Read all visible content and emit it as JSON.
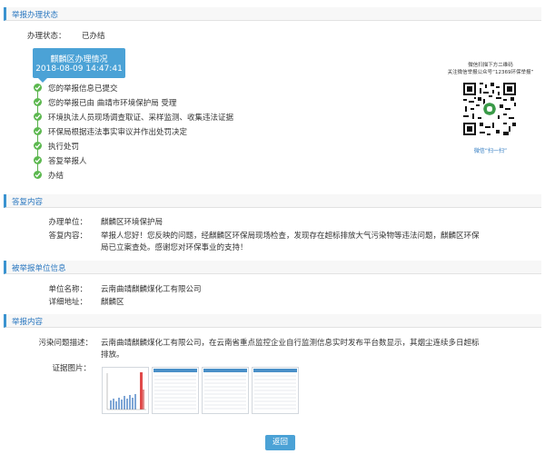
{
  "section_status": {
    "title": "举报办理状态"
  },
  "status": {
    "label": "办理状态：",
    "value": "已办结"
  },
  "card": {
    "title": "麒麟区办理情况",
    "time": "2018-08-09 14:47:41"
  },
  "steps": [
    "您的举报信息已提交",
    "您的举报已由 曲靖市环境保护局 受理",
    "环境执法人员现场调查取证、采样监测、收集违法证据",
    "环保局根据违法事实审议并作出处罚决定",
    "执行处罚",
    "答复举报人",
    "办结"
  ],
  "qr": {
    "caption_line1": "微信扫描下方二维码",
    "caption_line2": "关注微信举报公众号“12369环保举报”",
    "footer": "微信“扫一扫”"
  },
  "section_reply": {
    "title": "答复内容"
  },
  "reply": {
    "unit_label": "办理单位：",
    "unit_value": "麒麟区环境保护局",
    "content_label": "答复内容：",
    "content_line1": "举报人您好！您反映的问题，经麒麟区环保局现场检查，发现存在超标排放大气污染物等违法问题，麒麟区环保",
    "content_line2": "局已立案查处。感谢您对环保事业的支持！"
  },
  "section_reported": {
    "title": "被举报单位信息"
  },
  "reported": {
    "name_label": "单位名称：",
    "name_value": "云南曲靖麒麟煤化工有限公司",
    "addr_label": "详细地址：",
    "addr_value": "麒麟区"
  },
  "section_report": {
    "title": "举报内容"
  },
  "report": {
    "desc_label": "污染问题描述：",
    "desc_line1": "云南曲靖麒麟煤化工有限公司，在云南省重点监控企业自行监测信息实时发布平台数显示，其烟尘连续多日超标",
    "desc_line2": "排放。",
    "images_label": "证据图片："
  },
  "buttons": {
    "back": "返回"
  },
  "colors": {
    "accent": "#4ba2d6",
    "step_green": "#5cb84f",
    "header_text": "#2b78c0"
  }
}
